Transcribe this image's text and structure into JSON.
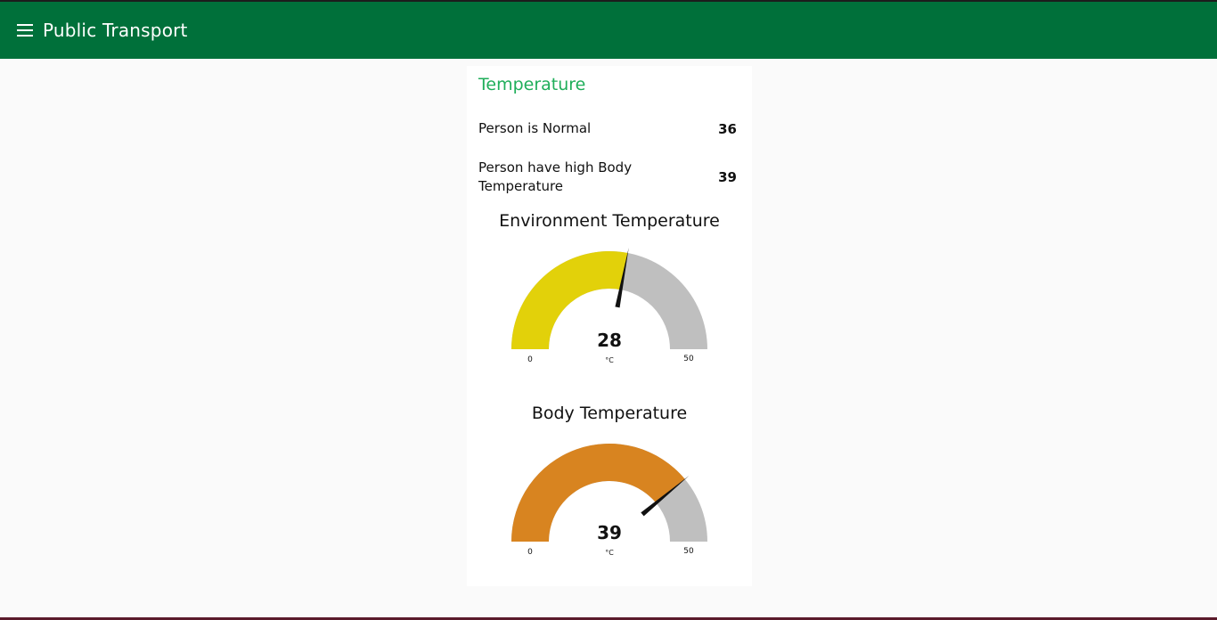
{
  "header": {
    "title": "Public Transport"
  },
  "card": {
    "title": "Temperature",
    "rows": [
      {
        "label": "Person is Normal",
        "value": "36"
      },
      {
        "label": "Person have high Body Temperature",
        "value": "39"
      }
    ]
  },
  "gauges": [
    {
      "title": "Environment Temperature",
      "value": 28,
      "display_value": "28",
      "unit": "°C",
      "min": 0,
      "max": 50,
      "min_label": "0",
      "max_label": "50",
      "fill_color": "#e2d10a"
    },
    {
      "title": "Body Temperature",
      "value": 39,
      "display_value": "39",
      "unit": "°C",
      "min": 0,
      "max": 50,
      "min_label": "0",
      "max_label": "50",
      "fill_color": "#d88420"
    }
  ],
  "colors": {
    "header_bg": "#00703a",
    "accent": "#1fae5a",
    "gauge_track": "#bfbfbf",
    "needle": "#111111"
  },
  "icons": {
    "menu": "hamburger-menu-icon"
  }
}
